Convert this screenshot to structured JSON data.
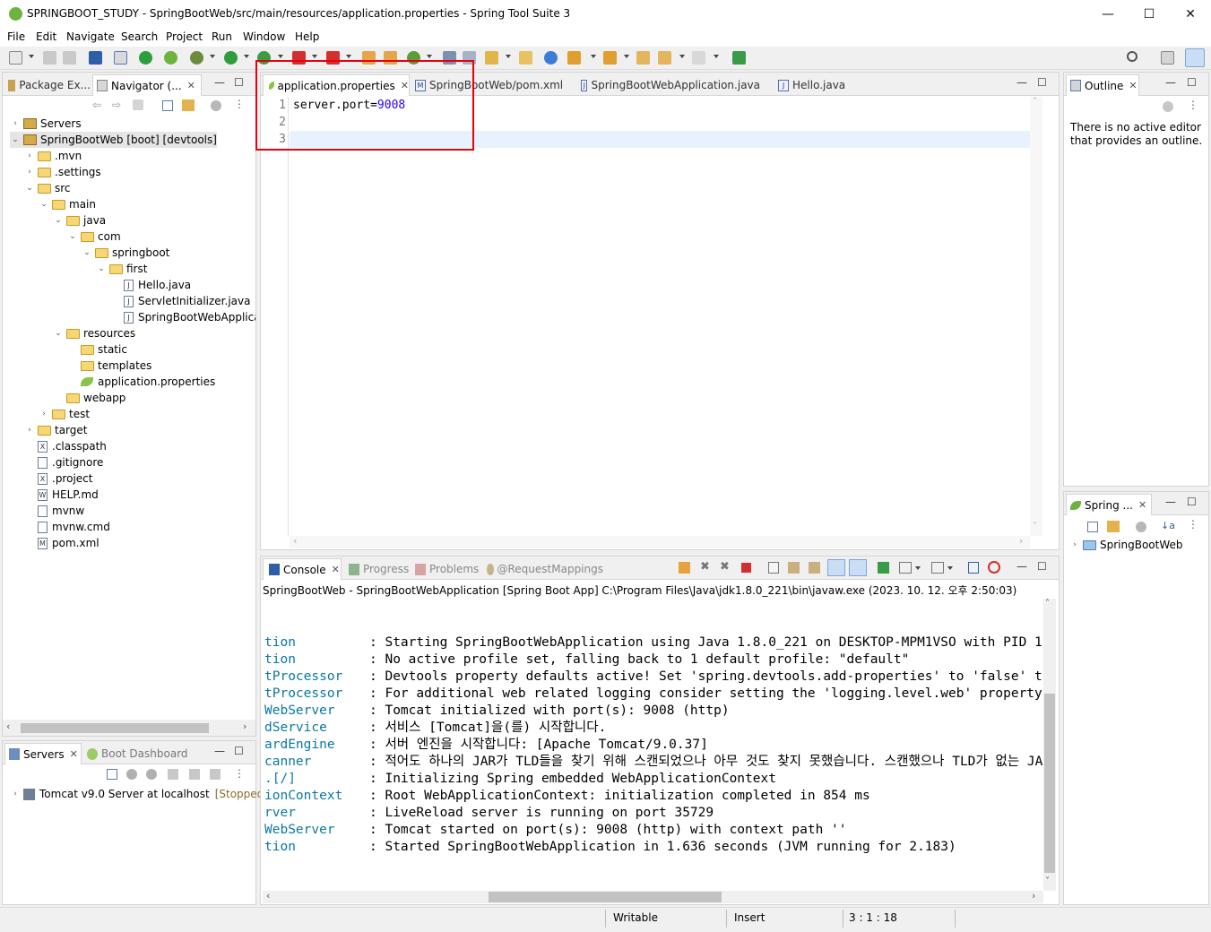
{
  "window": {
    "title": "SPRINGBOOT_STUDY - SpringBootWeb/src/main/resources/application.properties - Spring Tool Suite 3",
    "minimize": "—",
    "maximize": "☐",
    "close": "✕"
  },
  "menu": [
    "File",
    "Edit",
    "Navigate",
    "Search",
    "Project",
    "Run",
    "Window",
    "Help"
  ],
  "left_panel": {
    "tabs": [
      {
        "label": "Package Ex..."
      },
      {
        "label": "Navigator (..."
      }
    ],
    "tree": [
      {
        "label": "Servers",
        "depth": 0,
        "twisty": "›",
        "icon": "project"
      },
      {
        "label": "SpringBootWeb [boot] [devtools]",
        "depth": 0,
        "twisty": "⌄",
        "icon": "project"
      },
      {
        "label": ".mvn",
        "depth": 1,
        "twisty": "›",
        "icon": "folder"
      },
      {
        "label": ".settings",
        "depth": 1,
        "twisty": "›",
        "icon": "folder"
      },
      {
        "label": "src",
        "depth": 1,
        "twisty": "⌄",
        "icon": "folder"
      },
      {
        "label": "main",
        "depth": 2,
        "twisty": "⌄",
        "icon": "folder"
      },
      {
        "label": "java",
        "depth": 3,
        "twisty": "⌄",
        "icon": "folder"
      },
      {
        "label": "com",
        "depth": 4,
        "twisty": "⌄",
        "icon": "folder"
      },
      {
        "label": "springboot",
        "depth": 5,
        "twisty": "⌄",
        "icon": "folder"
      },
      {
        "label": "first",
        "depth": 6,
        "twisty": "⌄",
        "icon": "folder"
      },
      {
        "label": "Hello.java",
        "depth": 7,
        "twisty": "",
        "icon": "java"
      },
      {
        "label": "ServletInitializer.java",
        "depth": 7,
        "twisty": "",
        "icon": "java"
      },
      {
        "label": "SpringBootWebApplicat",
        "depth": 7,
        "twisty": "",
        "icon": "java"
      },
      {
        "label": "resources",
        "depth": 3,
        "twisty": "⌄",
        "icon": "folder"
      },
      {
        "label": "static",
        "depth": 4,
        "twisty": "",
        "icon": "folder"
      },
      {
        "label": "templates",
        "depth": 4,
        "twisty": "",
        "icon": "folder"
      },
      {
        "label": "application.properties",
        "depth": 4,
        "twisty": "",
        "icon": "leaf"
      },
      {
        "label": "webapp",
        "depth": 3,
        "twisty": "",
        "icon": "folder"
      },
      {
        "label": "test",
        "depth": 2,
        "twisty": "›",
        "icon": "folder"
      },
      {
        "label": "target",
        "depth": 1,
        "twisty": "›",
        "icon": "folder"
      },
      {
        "label": ".classpath",
        "depth": 1,
        "twisty": "",
        "icon": "file-x"
      },
      {
        "label": ".gitignore",
        "depth": 1,
        "twisty": "",
        "icon": "file"
      },
      {
        "label": ".project",
        "depth": 1,
        "twisty": "",
        "icon": "file-x"
      },
      {
        "label": "HELP.md",
        "depth": 1,
        "twisty": "",
        "icon": "file-w"
      },
      {
        "label": "mvnw",
        "depth": 1,
        "twisty": "",
        "icon": "file"
      },
      {
        "label": "mvnw.cmd",
        "depth": 1,
        "twisty": "",
        "icon": "file"
      },
      {
        "label": "pom.xml",
        "depth": 1,
        "twisty": "",
        "icon": "file-m"
      }
    ]
  },
  "servers_panel": {
    "tabs": [
      {
        "label": "Servers"
      },
      {
        "label": "Boot Dashboard"
      }
    ],
    "server": {
      "name": "Tomcat v9.0 Server at localhost",
      "status": "[Stopped]"
    }
  },
  "editor": {
    "tabs": [
      {
        "label": "application.properties"
      },
      {
        "label": "SpringBootWeb/pom.xml"
      },
      {
        "label": "SpringBootWebApplication.java"
      },
      {
        "label": "Hello.java"
      }
    ],
    "line_numbers": [
      "1",
      "2",
      "3"
    ],
    "line1_key": "server.port=",
    "line1_value": "9008"
  },
  "outline": {
    "tab": "Outline",
    "message": "There is no active editor that provides an outline."
  },
  "spring_panel": {
    "tab": "Spring ...",
    "item": "SpringBootWeb"
  },
  "console": {
    "tabs": [
      {
        "label": "Console"
      },
      {
        "label": "Progress"
      },
      {
        "label": "Problems"
      },
      {
        "label": "@RequestMappings"
      }
    ],
    "header": "SpringBootWeb - SpringBootWebApplication [Spring Boot App] C:\\Program Files\\Java\\jdk1.8.0_221\\bin\\javaw.exe  (2023. 10. 12. 오후 2:50:03)",
    "lines": [
      {
        "logger": "tion",
        "msg": ": Starting SpringBootWebApplication using Java 1.8.0_221 on DESKTOP-MPM1VSO with PID 1"
      },
      {
        "logger": "tion",
        "msg": ": No active profile set, falling back to 1 default profile: \"default\""
      },
      {
        "logger": "tProcessor",
        "msg": ": Devtools property defaults active! Set 'spring.devtools.add-properties' to 'false' t"
      },
      {
        "logger": "tProcessor",
        "msg": ": For additional web related logging consider setting the 'logging.level.web' property"
      },
      {
        "logger": "WebServer",
        "msg": ": Tomcat initialized with port(s): 9008 (http)"
      },
      {
        "logger": "dService",
        "msg": ": 서비스 [Tomcat]을(를) 시작합니다."
      },
      {
        "logger": "ardEngine",
        "msg": ": 서버 엔진을 시작합니다: [Apache Tomcat/9.0.37]"
      },
      {
        "logger": "canner",
        "msg": ": 적어도 하나의 JAR가 TLD들을 찾기 위해 스캔되었으나 아무 것도 찾지 못했습니다. 스캔했으나 TLD가 없는 JAR들의 전체 목록을 보시"
      },
      {
        "logger": ".[/]",
        "msg": ": Initializing Spring embedded WebApplicationContext"
      },
      {
        "logger": "ionContext",
        "msg": ": Root WebApplicationContext: initialization completed in 854 ms"
      },
      {
        "logger": "rver",
        "msg": ": LiveReload server is running on port 35729"
      },
      {
        "logger": "WebServer",
        "msg": ": Tomcat started on port(s): 9008 (http) with context path ''"
      },
      {
        "logger": "tion",
        "msg": ": Started SpringBootWebApplication in 1.636 seconds (JVM running for 2.183)"
      }
    ]
  },
  "status": {
    "writable": "Writable",
    "insert": "Insert",
    "position": "3 : 1 : 18"
  },
  "colors": {
    "highlight_box": "#e8000b",
    "logger_text": "#0b77a3",
    "value_text": "#2a00ff",
    "spring_green": "#6db33f"
  }
}
